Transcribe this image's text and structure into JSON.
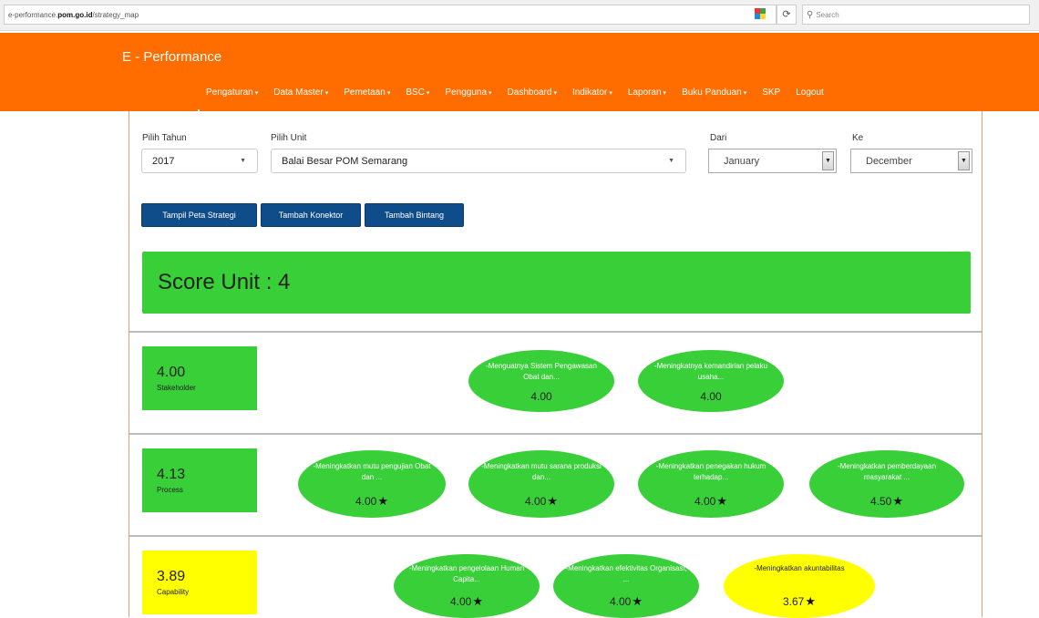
{
  "browser": {
    "url_prefix": "e-performance.",
    "url_domain": "pom.go.id",
    "url_path": "/strategy_map",
    "search_placeholder": "Search",
    "reload_icon": "reload-icon"
  },
  "app": {
    "brand": "E - Performance",
    "menu": [
      {
        "label": "Pengaturan",
        "caret": true
      },
      {
        "label": "Data Master",
        "caret": true
      },
      {
        "label": "Pemetaan",
        "caret": true
      },
      {
        "label": "BSC",
        "caret": true
      },
      {
        "label": "Pengguna",
        "caret": true
      },
      {
        "label": "Dashboard",
        "caret": true
      },
      {
        "label": "Indikator",
        "caret": true
      },
      {
        "label": "Laporan",
        "caret": true
      },
      {
        "label": "Buku Panduan",
        "caret": true
      },
      {
        "label": "SKP",
        "caret": false
      },
      {
        "label": "Logout",
        "caret": false
      }
    ]
  },
  "filters": {
    "tahun_label": "Pilih Tahun",
    "tahun_value": "2017",
    "unit_label": "Pilih Unit",
    "unit_value": "Balai Besar POM Semarang",
    "dari_label": "Dari",
    "dari_value": "January",
    "ke_label": "Ke",
    "ke_value": "December"
  },
  "buttons": {
    "tampil": "Tampil Peta Strategi",
    "konektor": "Tambah Konektor",
    "bintang": "Tambah Bintang"
  },
  "score": {
    "text": "Score Unit : 4",
    "color": "#38cf38"
  },
  "colors": {
    "green": "#38cf38",
    "yellow": "#ffff00",
    "orange": "#ff6d00",
    "navy": "#0f4c8a"
  },
  "perspectives": [
    {
      "value": "4.00",
      "label": "Stakeholder",
      "color": "green",
      "objectives": [
        {
          "text": "-Menguatnya Sistem Pengawasan Obat dan...",
          "value": "4.00",
          "star": false,
          "color": "green"
        },
        {
          "text": "-Meningkatnya kemandirian pelaku usaha...",
          "value": "4.00",
          "star": false,
          "color": "green"
        }
      ]
    },
    {
      "value": "4.13",
      "label": "Process",
      "color": "green",
      "objectives": [
        {
          "text": "-Meningkatkan mutu pengujian Obat dan ...",
          "value": "4.00",
          "star": true,
          "color": "green"
        },
        {
          "text": "-Meningkatkan mutu sarana produksi dan...",
          "value": "4.00",
          "star": true,
          "color": "green"
        },
        {
          "text": "-Meningkatkan penegakan hukum terhadap...",
          "value": "4.00",
          "star": true,
          "color": "green"
        },
        {
          "text": "-Meningkatkan pemberdayaan masyarakat ...",
          "value": "4.50",
          "star": true,
          "color": "green"
        }
      ]
    },
    {
      "value": "3.89",
      "label": "Capability",
      "color": "yellow",
      "objectives": [
        {
          "text": "-Meningkatkan pengelolaan Human Capita...",
          "value": "4.00",
          "star": true,
          "color": "green"
        },
        {
          "text": "-Meningkatkan efektivitas Organisasi, ...",
          "value": "4.00",
          "star": true,
          "color": "green"
        },
        {
          "text": "-Meningkatkan akuntabilitas",
          "value": "3.67",
          "star": true,
          "color": "yellow"
        }
      ]
    }
  ]
}
